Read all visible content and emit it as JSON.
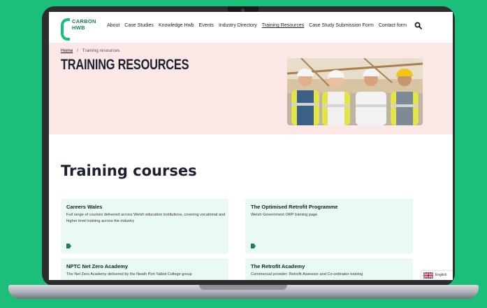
{
  "logo": {
    "line1": "CARBON",
    "line2": "HWB",
    "color": "#1dbd7a"
  },
  "nav": {
    "items": [
      "About",
      "Case Studies",
      "Knowledge Hwb",
      "Events",
      "Industry Directory",
      "Training Resources",
      "Case Study Submission Form",
      "Contact form"
    ],
    "active": "Training Resources"
  },
  "breadcrumb": {
    "home": "Home",
    "separator": "/",
    "current": "Training resources"
  },
  "hero": {
    "title": "TRAINING RESOURCES",
    "background": "#fbe8e6"
  },
  "section": {
    "title": "Training courses"
  },
  "cards": [
    {
      "title": "Careers Wales",
      "description": "Full range of courses delivered across Welsh education institutions, covering vocational and higher level training across the industry"
    },
    {
      "title": "The Optimised Retrofit Programme",
      "description": "Welsh Government ORP training page"
    },
    {
      "title": "NPTC Net Zero Academy",
      "description": "The Net Zero Academy delivered by the Neath Port Talbot College group"
    },
    {
      "title": "The Retrofit Academy",
      "description": "Commercial provider: Retrofit Assessor and Co-ordinator training"
    }
  ],
  "language": {
    "label": "English"
  },
  "colors": {
    "accent": "#1dbd7a",
    "card_bg": "#eafaf3",
    "heading": "#1c2130"
  }
}
